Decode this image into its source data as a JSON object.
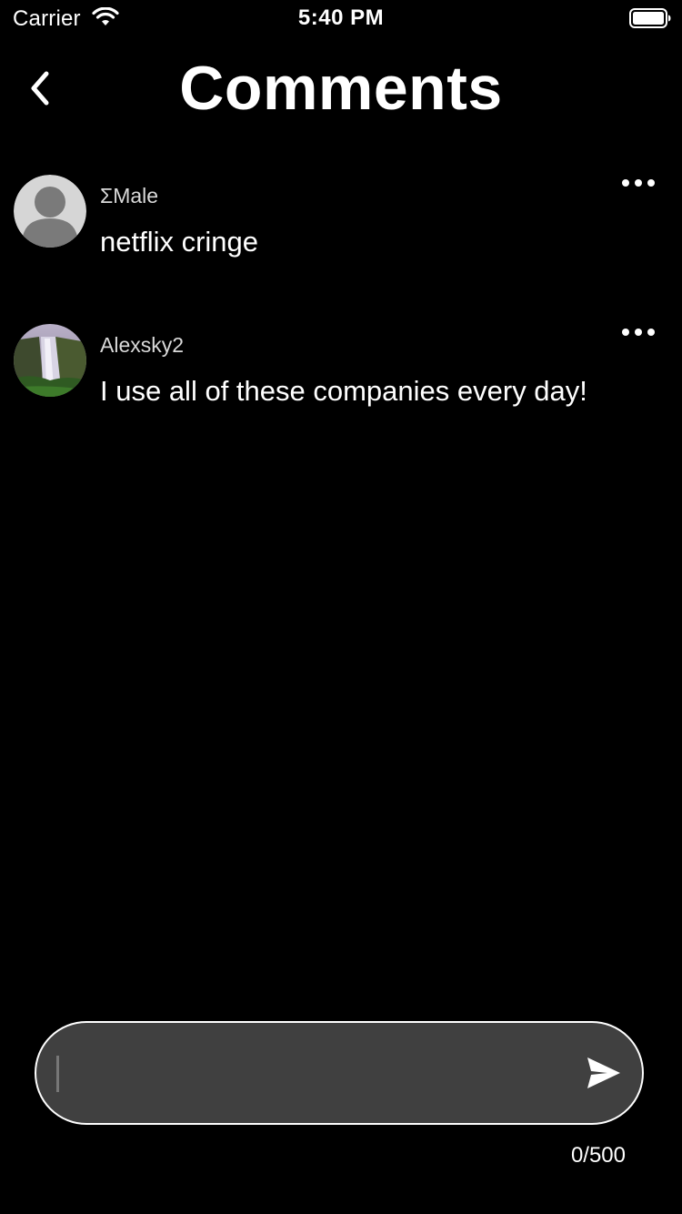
{
  "status_bar": {
    "carrier": "Carrier",
    "time": "5:40 PM",
    "wifi_icon": "wifi-icon",
    "battery_icon": "battery-icon"
  },
  "header": {
    "title": "Comments",
    "back_icon": "chevron-left-icon"
  },
  "comments": [
    {
      "username": "ΣMale",
      "text": "netflix cringe",
      "avatar": "default-person-avatar",
      "more_icon": "ellipsis-icon"
    },
    {
      "username": "Alexsky2",
      "text": "I use all of these companies every day!",
      "avatar": "waterfall-photo-avatar",
      "more_icon": "ellipsis-icon"
    }
  ],
  "composer": {
    "value": "",
    "placeholder": "",
    "send_icon": "send-icon",
    "counter": "0/500"
  },
  "colors": {
    "background": "#000000",
    "text": "#ffffff",
    "username": "#d9d9d9",
    "input_fill": "#404040",
    "input_border": "#ffffff"
  }
}
